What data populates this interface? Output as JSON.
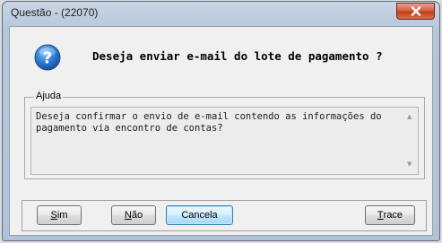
{
  "window": {
    "title": "Questão - (22070)",
    "close_icon": "close-icon"
  },
  "dialog": {
    "icon": "question-icon",
    "question": "Deseja enviar e-mail do lote de pagamento ?"
  },
  "help": {
    "label": "Ajuda",
    "text": "Deseja confirmar o envio de e-mail contendo as informações do\npagamento via encontro de contas?",
    "scroll_up_icon": "scroll-up-icon",
    "scroll_down_icon": "scroll-down-icon"
  },
  "buttons": {
    "sim": {
      "first": "S",
      "rest": "im"
    },
    "nao": {
      "first": "N",
      "rest": "ão"
    },
    "cancela": "Cancela",
    "trace": {
      "first": "T",
      "rest": "race"
    }
  },
  "colors": {
    "close_button": "#c43c19",
    "question_icon": "#2f7fd6",
    "default_button_border": "#3c7fb1"
  }
}
